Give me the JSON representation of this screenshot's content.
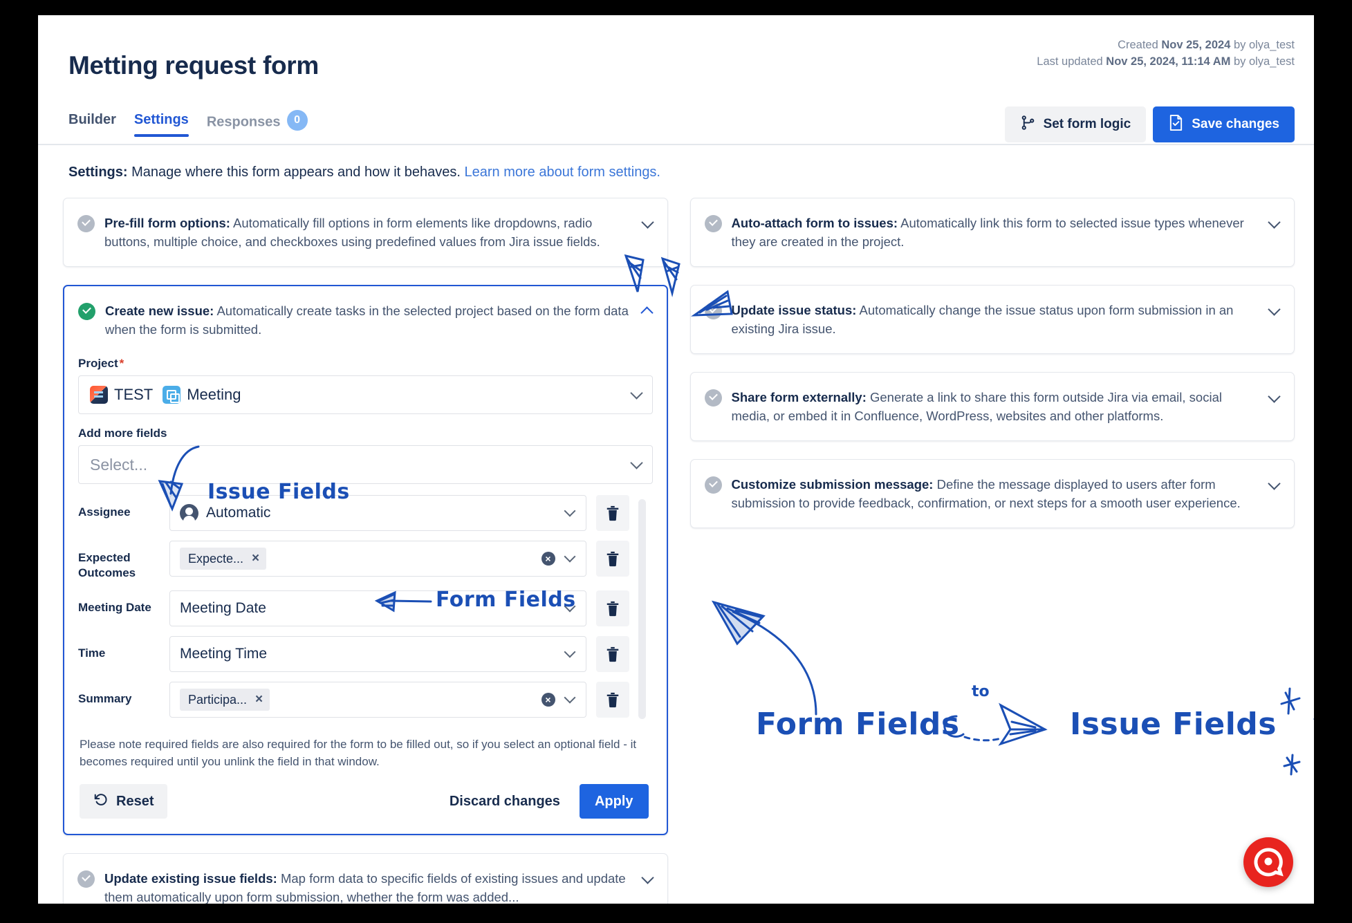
{
  "header": {
    "title": "Metting request form",
    "created_prefix": "Created ",
    "created_date": "Nov 25, 2024",
    "created_suffix": " by olya_test",
    "updated_prefix": "Last updated ",
    "updated_date": "Nov 25, 2024, 11:14 AM",
    "updated_suffix": " by olya_test",
    "tabs": [
      {
        "label": "Builder",
        "state": "inactive"
      },
      {
        "label": "Settings",
        "state": "active"
      },
      {
        "label": "Responses",
        "state": "muted",
        "badge": "0"
      }
    ],
    "actions": {
      "set_form_logic": "Set form logic",
      "save_changes": "Save changes"
    }
  },
  "settings_line": {
    "bold": "Settings:",
    "text": " Manage where this form appears and how it behaves. ",
    "link": "Learn more about form settings."
  },
  "left_cards": [
    {
      "title": "Pre-fill form options:",
      "desc": " Automatically fill options in form elements like dropdowns, radio buttons, multiple choice, and checkboxes using predefined values from Jira issue fields.",
      "enabled": false,
      "expanded": false
    }
  ],
  "create_issue_card": {
    "title": "Create new issue:",
    "desc": " Automatically create tasks in the selected project based on the form data when the form is submitted.",
    "enabled": true,
    "expanded": true,
    "project_label": "Project",
    "project_required_mark": "*",
    "project_value_project": "TEST",
    "project_value_type": "Meeting",
    "add_more_label": "Add more fields",
    "add_more_placeholder": "Select...",
    "rows": [
      {
        "label": "Assignee",
        "kind": "avatar",
        "value": "Automatic",
        "clearable": false
      },
      {
        "label": "Expected Outcomes",
        "kind": "chip",
        "value": "Expecte...",
        "clearable": true
      },
      {
        "label": "Meeting Date",
        "kind": "text",
        "value": "Meeting Date",
        "clearable": false
      },
      {
        "label": "Time",
        "kind": "text",
        "value": "Meeting Time",
        "clearable": false
      },
      {
        "label": "Summary",
        "kind": "chip",
        "value": "Participa...",
        "clearable": true
      }
    ],
    "note": "Please note required fields are also required for the form to be filled out, so if you select an optional field - it becomes required until you unlink the field in that window.",
    "reset_label": "Reset",
    "discard_label": "Discard changes",
    "apply_label": "Apply"
  },
  "bottom_card": {
    "title": "Update existing issue fields:",
    "desc": " Map form data to specific fields of existing issues and update them automatically upon form submission, whether the form was added...",
    "enabled": false
  },
  "right_cards": [
    {
      "title": "Auto-attach form to issues:",
      "desc": " Automatically link this form to selected issue types whenever they are created in the project.",
      "enabled": false
    },
    {
      "title": "Update issue status:",
      "desc": " Automatically change the issue status upon form submission in an existing Jira issue.",
      "enabled": false
    },
    {
      "title": "Share form externally:",
      "desc": " Generate a link to share this form outside Jira via email, social media, or embed it in Confluence, WordPress, websites and other platforms.",
      "enabled": false
    },
    {
      "title": "Customize submission message:",
      "desc": " Define the message displayed to users after form submission to provide feedback, confirmation, or next steps for a smooth user experience.",
      "enabled": false
    }
  ],
  "annotations": {
    "issue_fields": "Issue Fields",
    "form_fields": "Form Fields",
    "big_form_fields": "Form Fields",
    "big_to": "to",
    "big_issue_fields": "Issue Fields"
  },
  "colors": {
    "accent_blue": "#1e64e0",
    "link_blue": "#3b76d8",
    "doodle_blue": "#1b4fb5",
    "green_check": "#22a06b",
    "grey_check": "#b3bac5",
    "helper_red": "#e8241f",
    "badge_blue": "#85b8f5"
  },
  "helper_widget": {
    "icon": "chat-target-icon"
  }
}
